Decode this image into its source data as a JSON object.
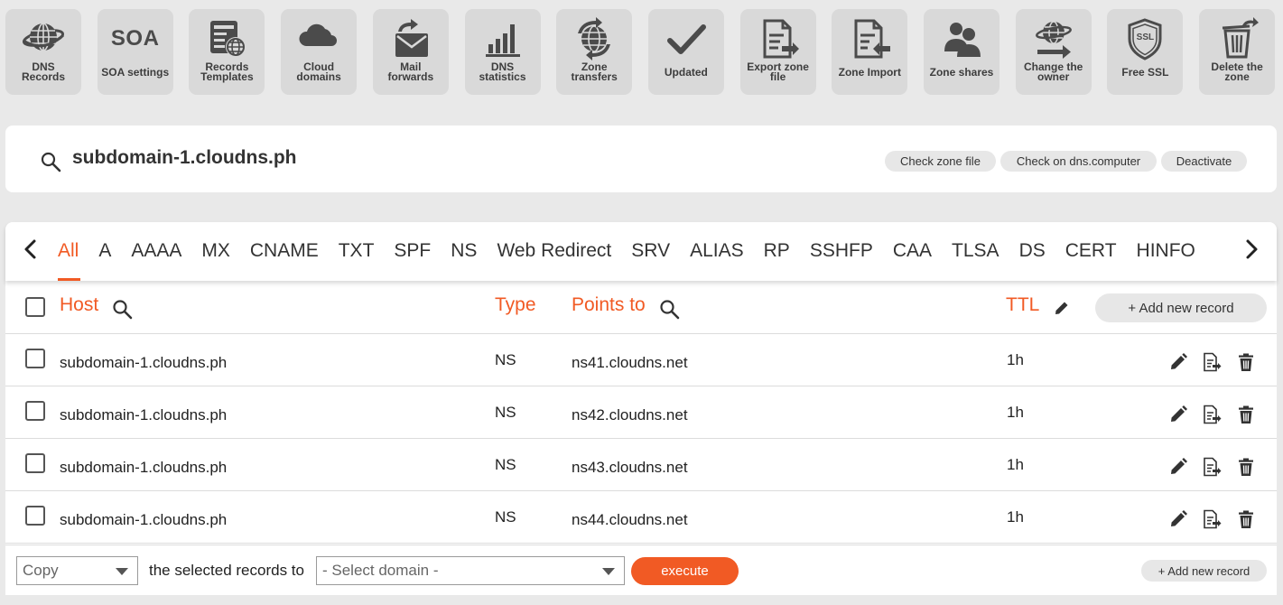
{
  "toolbar": [
    {
      "label": "DNS Records",
      "icon": "globe-icon"
    },
    {
      "label": "SOA settings",
      "icon": "soa-icon",
      "icon_text": "SOA"
    },
    {
      "label": "Records Templates",
      "icon": "template-icon"
    },
    {
      "label": "Cloud domains",
      "icon": "cloud-icon"
    },
    {
      "label": "Mail forwards",
      "icon": "mail-icon"
    },
    {
      "label": "DNS statistics",
      "icon": "bar-chart-icon"
    },
    {
      "label": "Zone transfers",
      "icon": "globe-transfer-icon"
    },
    {
      "label": "Updated",
      "icon": "checkmark-icon"
    },
    {
      "label": "Export zone file",
      "icon": "file-export-icon"
    },
    {
      "label": "Zone Import",
      "icon": "file-import-icon"
    },
    {
      "label": "Zone shares",
      "icon": "users-icon"
    },
    {
      "label": "Change the owner",
      "icon": "globe-arrow-icon"
    },
    {
      "label": "Free SSL",
      "icon": "ssl-shield-icon",
      "icon_text": "SSL"
    },
    {
      "label": "Delete the zone",
      "icon": "trash-icon"
    }
  ],
  "zone": {
    "name": "subdomain-1.cloudns.ph",
    "actions": [
      "Check zone file",
      "Check on dns.computer",
      "Deactivate"
    ]
  },
  "tabs": {
    "active": "All",
    "items": [
      "All",
      "A",
      "AAAA",
      "MX",
      "CNAME",
      "TXT",
      "SPF",
      "NS",
      "Web Redirect",
      "SRV",
      "ALIAS",
      "RP",
      "SSHFP",
      "CAA",
      "TLSA",
      "DS",
      "CERT",
      "HINFO"
    ]
  },
  "table": {
    "headers": {
      "host": "Host",
      "type": "Type",
      "points_to": "Points to",
      "ttl": "TTL"
    },
    "add_label": "+ Add new record",
    "rows": [
      {
        "host": "subdomain-1.cloudns.ph",
        "type": "NS",
        "points_to": "ns41.cloudns.net",
        "ttl": "1h"
      },
      {
        "host": "subdomain-1.cloudns.ph",
        "type": "NS",
        "points_to": "ns42.cloudns.net",
        "ttl": "1h"
      },
      {
        "host": "subdomain-1.cloudns.ph",
        "type": "NS",
        "points_to": "ns43.cloudns.net",
        "ttl": "1h"
      },
      {
        "host": "subdomain-1.cloudns.ph",
        "type": "NS",
        "points_to": "ns44.cloudns.net",
        "ttl": "1h"
      }
    ]
  },
  "footer": {
    "action_select": "Copy",
    "middle_text": "the selected records to",
    "domain_select": "- Select domain -",
    "execute_label": "execute",
    "add_label": "+ Add new record"
  },
  "colors": {
    "accent": "#f15a24",
    "icon_dark": "#4b4b4b",
    "tile_bg": "#d9d9d9",
    "page_bg": "#e9e9e9"
  }
}
